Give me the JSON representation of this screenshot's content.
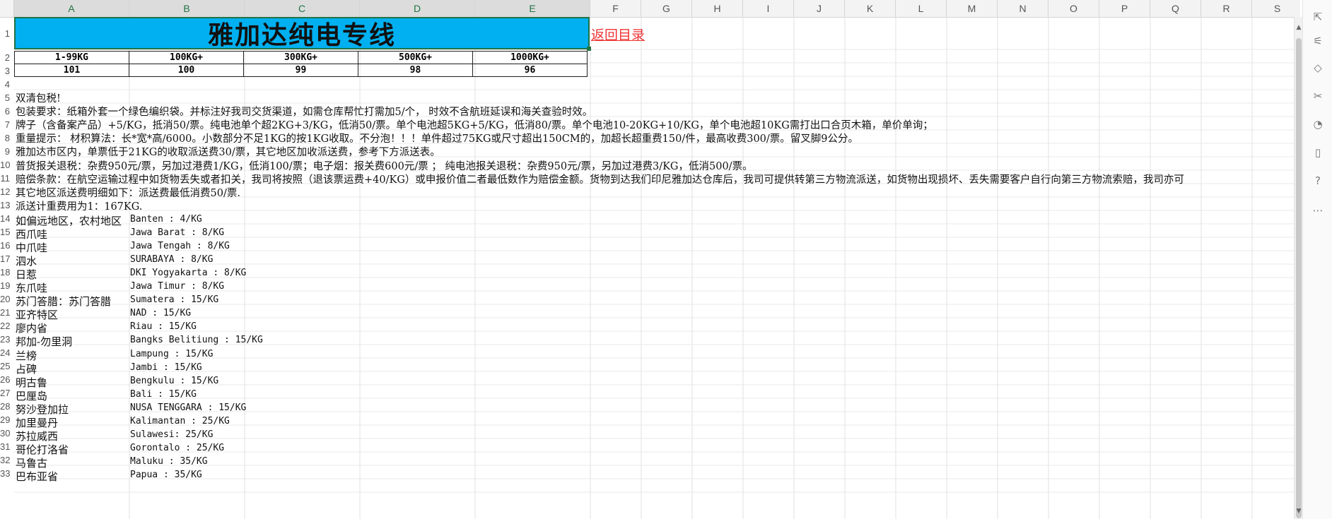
{
  "columns": [
    "A",
    "B",
    "C",
    "D",
    "E",
    "F",
    "G",
    "H",
    "I",
    "J",
    "K",
    "L",
    "M",
    "N",
    "O",
    "P",
    "Q",
    "R",
    "S"
  ],
  "title": "雅加达纯电专线",
  "back_link": "返回目录",
  "price_table": {
    "headers": [
      "1-99KG",
      "100KG+",
      "300KG+",
      "500KG+",
      "1000KG+"
    ],
    "values": [
      "101",
      "100",
      "99",
      "98",
      "96"
    ]
  },
  "notes": [
    "双清包税!",
    "包装要求：纸箱外套一个绿色编织袋。并标注好我司交货渠道，如需仓库帮忙打需加5/个， 时效不含航班延误和海关查验时效。",
    "牌子（含备案产品）+5/KG，抵消50/票。纯电池单个超2KG+3/KG，低消50/票。单个电池超5KG+5/KG，低消80/票。单个电池10-20KG+10/KG，单个电池超10KG需打出口合页木箱，单价单询；",
    "重量提示： 材积算法：长*宽*高/6000。小数部分不足1KG的按1KG收取。不分泡！！！单件超过75KG或尺寸超出150CM的，加超长超重费150/件，最高收费300/票。留叉脚9公分。",
    "雅加达市区内，单票低于21KG的收取派送费30/票，其它地区加收派送费，参考下方派送表。",
    "普货报关退税：杂费950元/票，另加过港费1/KG，低消100/票；电子烟：报关费600元/票 ； 纯电池报关退税：杂费950元/票，另加过港费3/KG，低消500/票。",
    "赔偿条款：在航空运输过程中如货物丢失或者扣关，我司将按照（退该票运费+40/KG）或申报价值二者最低数作为赔偿金额。货物到达我们印尼雅加达仓库后，我司可提供转第三方物流派送，如货物出现损坏、丢失需要客户自行向第三方物流索赔，我司亦可",
    "其它地区派送费明细如下：派送费最低消费50/票.",
    "派送计重费用为1：167KG."
  ],
  "delivery": [
    {
      "region": "如偏远地区，农村地区",
      "rate": "Banten : 4/KG"
    },
    {
      "region": "西爪哇",
      "rate": "Jawa Barat  : 8/KG"
    },
    {
      "region": "中爪哇",
      "rate": "Jawa Tengah  : 8/KG"
    },
    {
      "region": "泗水",
      "rate": "SURABAYA  : 8/KG"
    },
    {
      "region": "日惹",
      "rate": "DKI Yogyakarta  : 8/KG"
    },
    {
      "region": "东爪哇",
      "rate": "Jawa Timur : 8/KG"
    },
    {
      "region": "苏门答腊：苏门答腊",
      "rate": "Sumatera : 15/KG"
    },
    {
      "region": "亚齐特区",
      "rate": "NAD  : 15/KG"
    },
    {
      "region": "廖内省",
      "rate": "Riau  : 15/KG"
    },
    {
      "region": "邦加-勿里洞",
      "rate": "Bangks Belitiung : 15/KG"
    },
    {
      "region": "兰榜",
      "rate": "Lampung  : 15/KG"
    },
    {
      "region": "占碑",
      "rate": "Jambi  : 15/KG"
    },
    {
      "region": "明古鲁",
      "rate": "Bengkulu  : 15/KG"
    },
    {
      "region": "巴厘岛",
      "rate": "Bali : 15/KG"
    },
    {
      "region": "努沙登加拉",
      "rate": "NUSA TENGGARA  : 15/KG"
    },
    {
      "region": "加里曼丹",
      "rate": "Kalimantan : 25/KG"
    },
    {
      "region": "苏拉威西",
      "rate": "Sulawesi: 25/KG"
    },
    {
      "region": "哥伦打洛省",
      "rate": "Gorontalo : 25/KG"
    },
    {
      "region": "马鲁古",
      "rate": "Maluku  : 35/KG"
    },
    {
      "region": "巴布亚省",
      "rate": "Papua  : 35/KG"
    }
  ],
  "row_numbers": [
    "1",
    "2",
    "3",
    "4",
    "5",
    "6",
    "7",
    "8",
    "9",
    "10",
    "11",
    "12",
    "13",
    "14",
    "15",
    "16",
    "17",
    "18",
    "19",
    "20",
    "21",
    "22",
    "23",
    "24",
    "25",
    "26",
    "27",
    "28",
    "29",
    "30",
    "31",
    "32",
    "33"
  ],
  "tools": [
    "select-icon",
    "sliders-icon",
    "shape-icon",
    "tools-icon",
    "chart-icon",
    "book-icon",
    "help-icon",
    "more-icon"
  ],
  "tool_glyphs": [
    "⇱",
    "⚟",
    "◇",
    "✂",
    "◔",
    "▯",
    "?",
    "⋯"
  ],
  "scroll_up": "▲",
  "scroll_down": "▼"
}
